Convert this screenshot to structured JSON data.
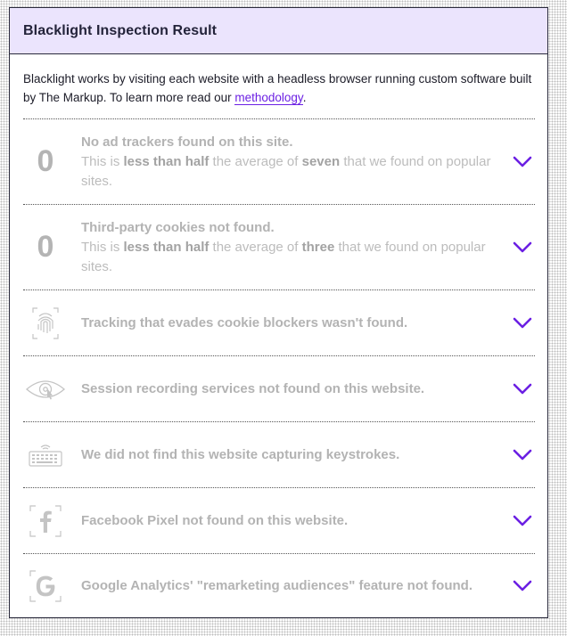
{
  "header": {
    "title": "Blacklight Inspection Result"
  },
  "intro": {
    "text_before": "Blacklight works by visiting each website with a headless browser running custom software built by The Markup. To learn more read our ",
    "link": "methodology",
    "text_after": "."
  },
  "rows": [
    {
      "number": "0",
      "title": "No ad trackers found on this site.",
      "sub_a": "This is ",
      "sub_b": "less than half",
      "sub_c": " the average of ",
      "sub_d": "seven",
      "sub_e": " that we found on popular sites."
    },
    {
      "number": "0",
      "title": "Third-party cookies not found.",
      "sub_a": "This is ",
      "sub_b": "less than half",
      "sub_c": " the average of ",
      "sub_d": "three",
      "sub_e": " that we found on popular sites."
    },
    {
      "icon": "fingerprint-icon",
      "title": "Tracking that evades cookie blockers wasn't found."
    },
    {
      "icon": "eye-icon",
      "title": "Session recording services not found on this website."
    },
    {
      "icon": "keyboard-icon",
      "title": "We did not find this website capturing keystrokes."
    },
    {
      "icon": "facebook-icon",
      "title": "Facebook Pixel not found on this website."
    },
    {
      "icon": "google-icon",
      "title": "Google Analytics' \"remarketing audiences\" feature not found."
    }
  ],
  "colors": {
    "accent": "#6b1fe3",
    "header_bg": "#ebe4fd",
    "muted_text": "#b9b9b9"
  }
}
